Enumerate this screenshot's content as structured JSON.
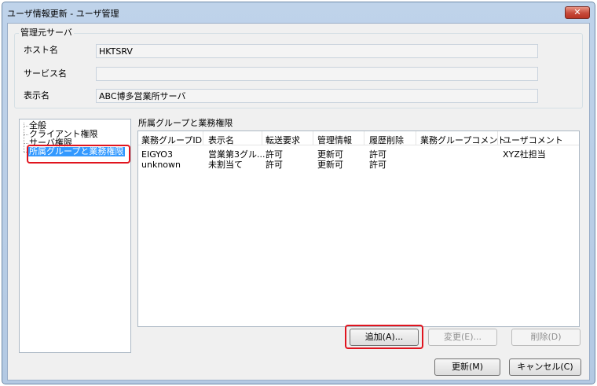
{
  "window": {
    "title": "ユーザ情報更新 - ユーザ管理",
    "close_glyph": "✕"
  },
  "server_group": {
    "caption": "管理元サーバ",
    "host_label": "ホスト名",
    "host_value": "HKTSRV",
    "service_label": "サービス名",
    "service_value": "",
    "display_label": "表示名",
    "display_value": "ABC博多営業所サーバ"
  },
  "tree": {
    "items": [
      "全般",
      "クライアント権限",
      "サーバ権限",
      "所属グループと業務権限"
    ],
    "selected_index": 3
  },
  "groups_panel": {
    "caption": "所属グループと業務権限",
    "columns": [
      "業務グループID",
      "表示名",
      "転送要求",
      "管理情報",
      "履歴削除",
      "業務グループコメント",
      "ユーザコメント"
    ],
    "rows": [
      [
        "EIGYO3",
        "営業第3グル...",
        "許可",
        "更新可",
        "許可",
        "",
        "XYZ社担当"
      ],
      [
        "unknown",
        "未割当て",
        "許可",
        "更新可",
        "許可",
        "",
        ""
      ]
    ]
  },
  "buttons": {
    "add": "追加(A)...",
    "modify": "変更(E)...",
    "delete": "削除(D)",
    "update": "更新(M)",
    "cancel": "キャンセル(C)"
  },
  "colors": {
    "highlight": "#e0141e",
    "selection": "#3399ff"
  }
}
